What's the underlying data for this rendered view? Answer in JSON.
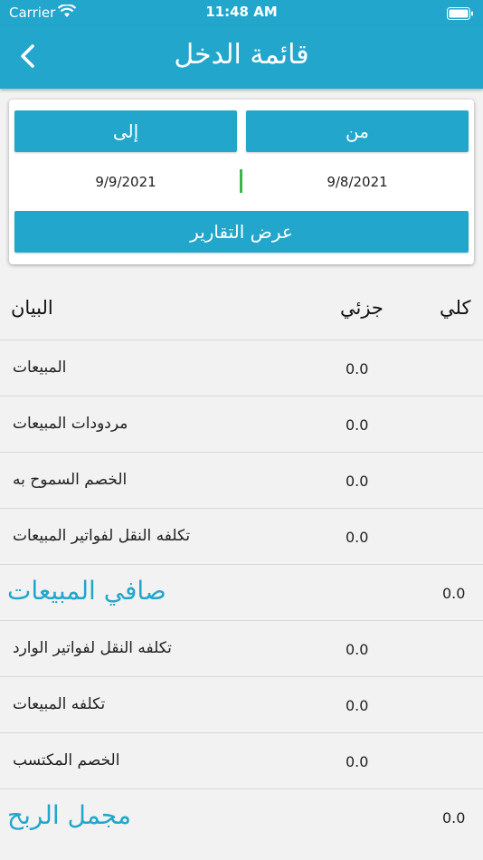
{
  "status_bar": {
    "carrier": "Carrier",
    "time": "11:48 AM"
  },
  "nav": {
    "title": "قائمة الدخل",
    "back_icon": "chevron-left-icon"
  },
  "filter": {
    "to_label": "إلى",
    "from_label": "من",
    "to_date": "9/9/2021",
    "from_date": "9/8/2021",
    "show_reports_label": "عرض التقارير"
  },
  "table": {
    "header_description": "البيان",
    "header_partial": "جزئي",
    "header_total": "كلي",
    "rows": [
      {
        "label": "المبيعات",
        "partial": "0.0",
        "total": ""
      },
      {
        "label": "مردودات المبيعات",
        "partial": "0.0",
        "total": ""
      },
      {
        "label": "الخصم السموح به",
        "partial": "0.0",
        "total": ""
      },
      {
        "label": "تكلفه النقل لفواتير المبيعات",
        "partial": "0.0",
        "total": ""
      },
      {
        "label": "صافي المبيعات",
        "partial": "",
        "total": "0.0"
      },
      {
        "label": "تكلفه النقل لفواتير الوارد",
        "partial": "0.0",
        "total": ""
      },
      {
        "label": "تكلفه المبيعات",
        "partial": "0.0",
        "total": ""
      },
      {
        "label": "الخصم المكتسب",
        "partial": "0.0",
        "total": ""
      },
      {
        "label": "مجمل الربح",
        "partial": "",
        "total": "0.0"
      }
    ]
  },
  "colors": {
    "accent": "#22a6cb",
    "divider_green": "#3bb54a"
  }
}
